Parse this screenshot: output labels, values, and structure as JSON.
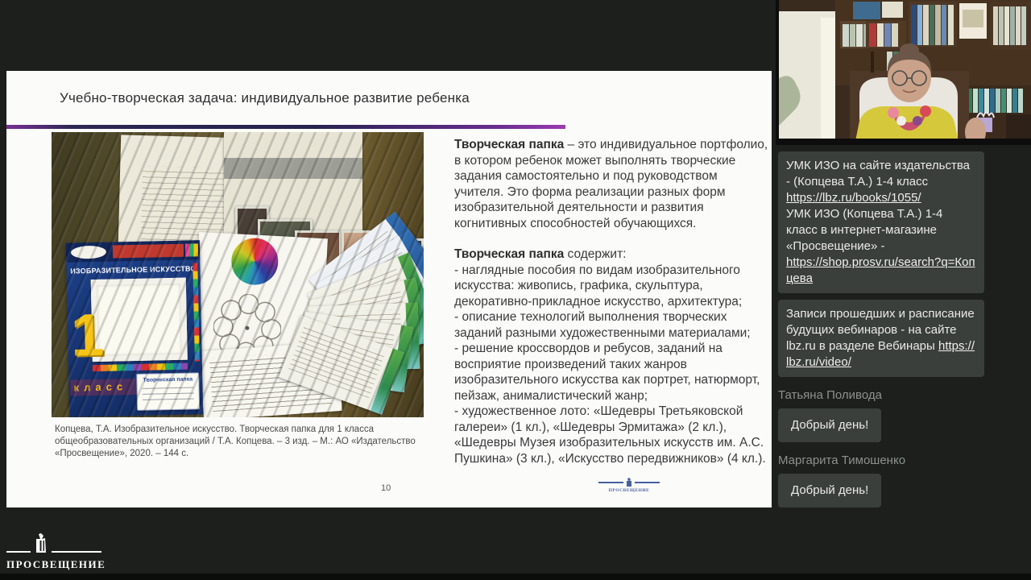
{
  "slide": {
    "title": "Учебно-творческая задача: индивидуальное развитие ребенка",
    "page_number": "10",
    "footer_logo_text": "ПРОСВЕЩЕНИЕ",
    "caption": "Копцева, Т.А. Изобразительное искусство. Творческая папка для 1 класса общеобразовательных организаций / Т.А. Копцева. – 3 изд. – М.: АО «Издательство «Просвещение», 2020. – 144 с.",
    "body": {
      "p1_bold": "Творческая папка",
      "p1_rest": " – это индивидуальное портфолио, в котором ребенок может выполнять творческие задания самостоятельно и под руководством учителя. Это форма реализации разных форм изобразительной деятельности и развития когнитивных способностей обучающихся.",
      "p2_bold": "Творческая папка",
      "p2_rest": "  содержит:",
      "items": [
        "- наглядные пособия по видам изобразительного искусства: живопись, графика, скульптура, декоративно-прикладное искусство, архитектура;",
        "- описание технологий выполнения творческих заданий разными художественными материалами;",
        "- решение кроссвордов и ребусов, заданий на восприятие произведений таких жанров изобразительного искусства как портрет, натюрморт, пейзаж, анималистический жанр;",
        "- художественное лото: «Шедевры Третьяковской галереи» (1 кл.), «Шедевры Эрмитажа» (2 кл.), «Шедевры Музея изобразительных искусств им. А.С. Пушкина» (3 кл.), «Искусство передвижников» (4 кл.)."
      ]
    },
    "photo": {
      "book_title": "ИЗОБРАЗИТЕЛЬНОЕ ИСКУССТВО",
      "book_number": "1",
      "book_class": "класс",
      "folder_label": "Творческая папка"
    }
  },
  "chat": {
    "bubble1": {
      "text1": "УМК ИЗО на сайте издательства - (Копцева Т.А.) 1-4 класс",
      "link1": "https://lbz.ru/books/1055/",
      "text2": "УМК ИЗО (Копцева Т.А.) 1-4 класс  в интернет-магазине «Просвещение» -",
      "link2": "https://shop.prosv.ru/search?q=Копцева"
    },
    "bubble2": {
      "text": "Записи прошедших и расписание будущих вебинаров - на сайте  lbz.ru  в разделе Вебинары ",
      "link": "https://lbz.ru/video/"
    },
    "entries": [
      {
        "author": "Татьяна Поливода",
        "message": "Добрый день!"
      },
      {
        "author": "Маргарита Тимошенко",
        "message": "Добрый день!"
      }
    ]
  },
  "footer": {
    "logo_text": "ПРОСВЕЩЕНИЕ"
  },
  "colors": {
    "accent_rule": "#262350",
    "chat_bubble": "#3b3f3c",
    "book_cover": "#1d4088"
  }
}
